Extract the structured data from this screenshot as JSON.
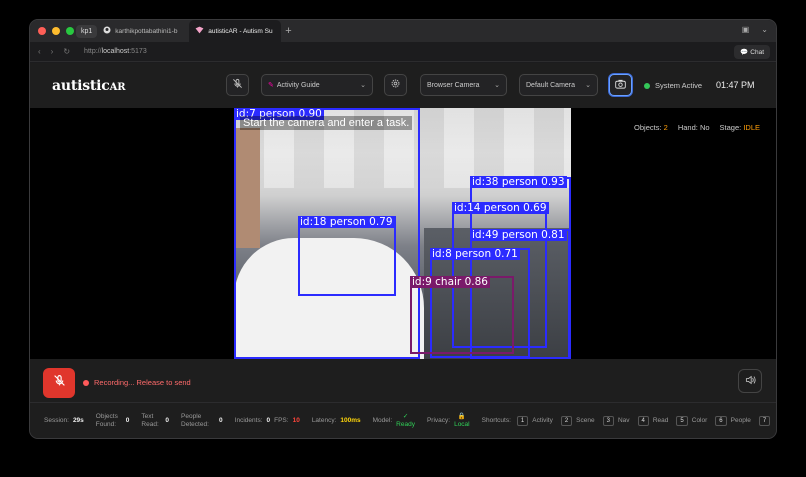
{
  "browser": {
    "profile": "kp1",
    "tabs": [
      {
        "title": "karthikpottabathini1-b",
        "active": false
      },
      {
        "title": "autisticAR - Autism Su",
        "active": true
      }
    ],
    "new_tab": "+",
    "url_prefix": "http://",
    "url_host": "localhost",
    "url_port": ":5173",
    "chat_label": "Chat"
  },
  "header": {
    "logo_main": "autistic",
    "logo_suffix": "AR",
    "activity_label": "Activity Guide",
    "camera_source": "Browser Camera",
    "camera_device": "Default Camera",
    "status": "System Active",
    "time": "01:47 PM"
  },
  "video": {
    "caption": "Start the camera and enter a task.",
    "detections": [
      {
        "label": "id:7 person 0.90",
        "color": "blue"
      },
      {
        "label": "id:38 person 0.93",
        "color": "blue"
      },
      {
        "label": "id:14 person 0.69",
        "color": "blue"
      },
      {
        "label": "id:18 person 0.79",
        "color": "blue"
      },
      {
        "label": "id:49 person 0.81",
        "color": "blue"
      },
      {
        "label": "id:8 person 0.71",
        "color": "blue"
      },
      {
        "label": "id:9 chair 0.86",
        "color": "purple"
      }
    ],
    "stats": {
      "objects_label": "Objects:",
      "objects": "2",
      "hand_label": "Hand:",
      "hand": "No",
      "stage_label": "Stage:",
      "stage": "IDLE"
    }
  },
  "recording": {
    "text": "Recording... Release to send"
  },
  "footer": {
    "session_label": "Session:",
    "session": "29s",
    "objects_label": "Objects Found:",
    "objects": "0",
    "text_label": "Text Read:",
    "text": "0",
    "people_label": "People Detected:",
    "people": "0",
    "incidents_label": "Incidents:",
    "incidents": "0",
    "fps_label": "FPS:",
    "fps": "10",
    "latency_label": "Latency:",
    "latency": "100ms",
    "model_label": "Model:",
    "model": "Ready",
    "privacy_label": "Privacy:",
    "privacy": "Local",
    "shortcuts_label": "Shortcuts:",
    "shortcuts": [
      {
        "key": "1",
        "label": "Activity"
      },
      {
        "key": "2",
        "label": "Scene"
      },
      {
        "key": "3",
        "label": "Nav"
      },
      {
        "key": "4",
        "label": "Read"
      },
      {
        "key": "5",
        "label": "Color"
      },
      {
        "key": "6",
        "label": "People"
      },
      {
        "key": "7",
        "label": ""
      }
    ]
  },
  "colors": {
    "accent_blue": "#2b2bff",
    "chair_purple": "#7a1a6a",
    "record_red": "#e0362c",
    "active_green": "#34c759",
    "stage_orange": "#ff9f0a"
  }
}
